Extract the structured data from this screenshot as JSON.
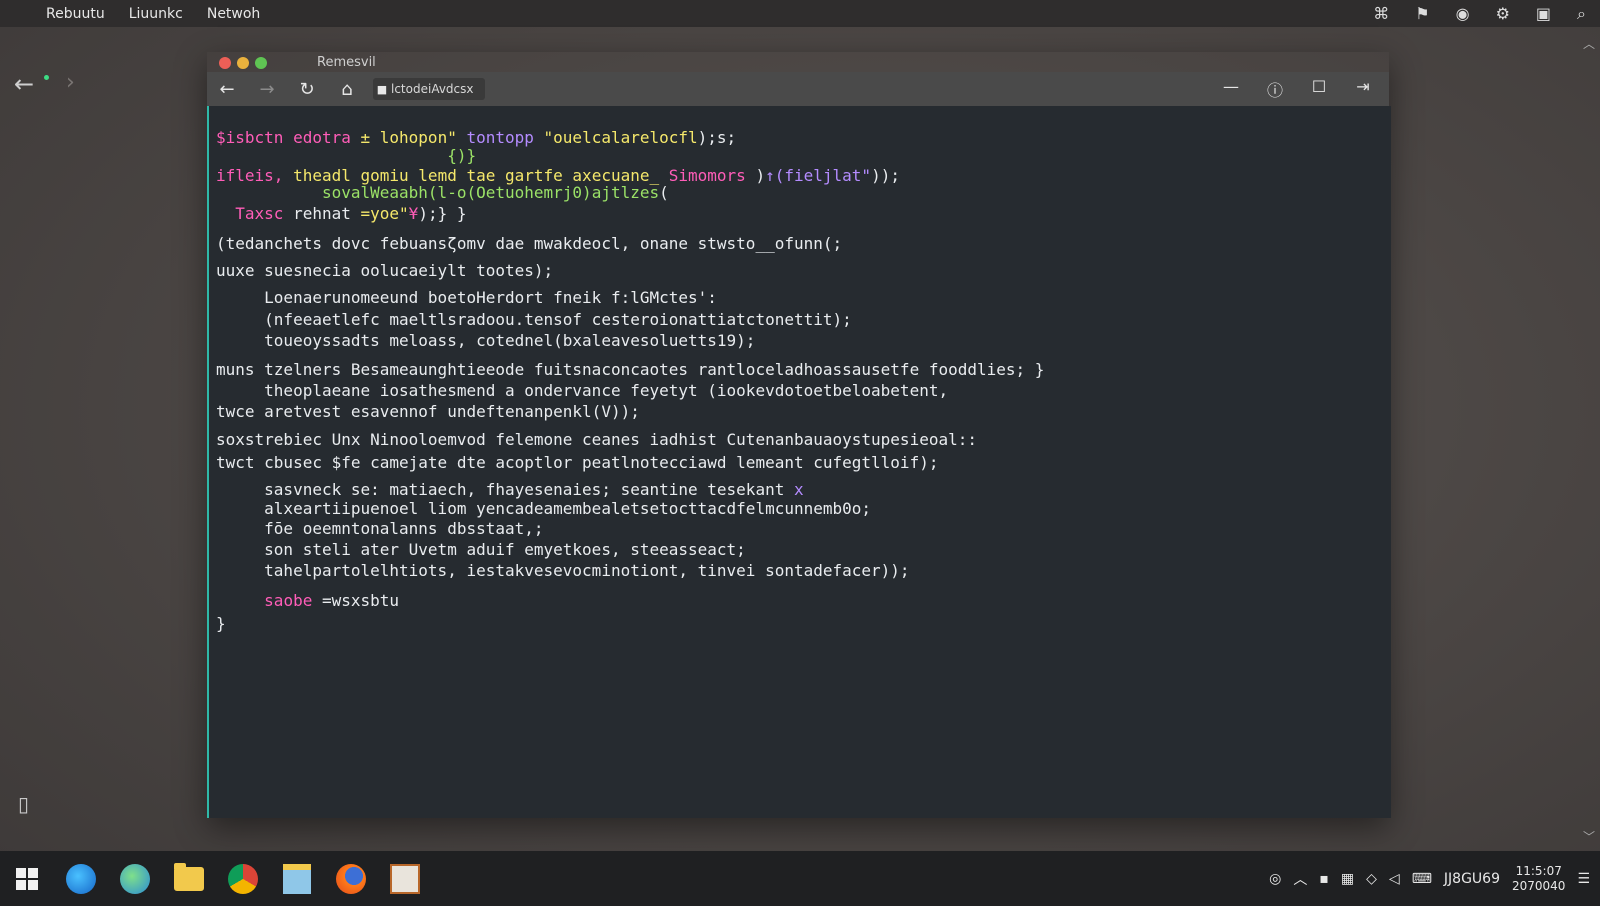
{
  "menubar": {
    "apple_icon": "apple-logo",
    "items": [
      "Rebuutu",
      "Liuunkc",
      "Netwoh"
    ],
    "right_icons": [
      "network-icon",
      "folder-flag-icon",
      "shield-icon",
      "settings-icon",
      "user-box-icon",
      "search-icon"
    ]
  },
  "window": {
    "title": "Remesvil",
    "address": "lctodeiAvdcsx",
    "toolbar_icons": [
      "back-icon",
      "forward-icon",
      "reload-icon",
      "home-icon",
      "lock-icon"
    ],
    "window_controls": [
      "minimize-icon",
      "info-icon",
      "maximize-icon",
      "forward-arrow-icon"
    ]
  },
  "code": {
    "lines": [
      {
        "segments": [
          {
            "t": "$isbctn edotra ",
            "c": "pink"
          },
          {
            "t": "± ",
            "c": "yellow"
          },
          {
            "t": "lohopon\" ",
            "c": "yellow"
          },
          {
            "t": "tontopp ",
            "c": "purple"
          },
          {
            "t": "\"ouelcalarelocfl",
            "c": "yellow"
          },
          {
            "t": ");s;",
            "c": "white"
          }
        ]
      },
      {
        "segments": [
          {
            "t": "                        {)}",
            "c": "green"
          }
        ]
      },
      {
        "segments": [
          {
            "t": "ifleis, ",
            "c": "pink"
          },
          {
            "t": "theadl ",
            "c": "yellow"
          },
          {
            "t": "gomiu lemd tae gartfe axecuane_ ",
            "c": "yellow"
          },
          {
            "t": "Simomors ",
            "c": "pink"
          },
          {
            "t": ")",
            "c": "white"
          },
          {
            "t": "↑(fieljlat\"",
            "c": "purple"
          },
          {
            "t": "));",
            "c": "white"
          }
        ]
      },
      {
        "segments": [
          {
            "t": "           sovalWeaabh(l-o(Oetuohemrj0)",
            "c": "green"
          },
          {
            "t": "ajtlzes",
            "c": "green"
          },
          {
            "t": "(",
            "c": "white"
          }
        ]
      },
      {
        "segments": [
          {
            "t": "  ",
            "c": "white"
          },
          {
            "t": "Taxsc ",
            "c": "pink"
          },
          {
            "t": "rehnat ",
            "c": "white"
          },
          {
            "t": "=yoe\"",
            "c": "yellow"
          },
          {
            "t": "¥",
            "c": "pink"
          },
          {
            "t": ");} }",
            "c": "white"
          }
        ]
      },
      {
        "segments": [
          {
            "t": "(tedanchets dovc febuansζomv dae mwakdeocl, onane stwsto__ofunn(;",
            "c": "white"
          }
        ]
      },
      {
        "segments": [
          {
            "t": "uuxe suesnecia oolucaeiylt tootes);",
            "c": "white"
          }
        ]
      },
      {
        "segments": [
          {
            "t": "     Loenaerunomeeund boetoHerdort fneik f:lGMctes':",
            "c": "white"
          }
        ]
      },
      {
        "segments": [
          {
            "t": "     (nfeeaetlefc maeltlsradoou.tensof cesteroionattiatctonettit);",
            "c": "white"
          }
        ]
      },
      {
        "segments": [
          {
            "t": "     toueoyssadts meloass, cotednel(bxaleavesoluetts19);",
            "c": "white"
          }
        ]
      },
      {
        "segments": [
          {
            "t": "muns tzelners Besameaunghtieeode fuitsnaconcaotes rantloceladhoassausetfe fooddlies; }",
            "c": "white"
          }
        ]
      },
      {
        "segments": [
          {
            "t": "     theoplaeane iosathesmend a ondervance feyetyt (iookevdotoetbeloabetent,",
            "c": "white"
          }
        ]
      },
      {
        "segments": [
          {
            "t": "twce aretvest esavennof undeftenanpenkl(V));",
            "c": "white"
          }
        ]
      },
      {
        "segments": [
          {
            "t": "soxstrebiec Unx Ninooloemvod felemone ceanes iadhist Cutenanbauaoystupesieoal::",
            "c": "white"
          }
        ]
      },
      {
        "segments": [
          {
            "t": "twct cbusec $fe camejate dte acoptlor peatlnotecciawd lemeant cufegtlloif);",
            "c": "white"
          }
        ]
      },
      {
        "segments": [
          {
            "t": "     sasvneck se: matiaech, fhayesenaies; seantine tesekant ",
            "c": "white"
          },
          {
            "t": "x",
            "c": "purple"
          }
        ]
      },
      {
        "segments": [
          {
            "t": "     alxeartiipuenoel liom yencadeamembealetsetocttacdfelmcunnemb0o;",
            "c": "white"
          }
        ]
      },
      {
        "segments": [
          {
            "t": "     fōe oeemntonalanns dbsstaat,;",
            "c": "white"
          }
        ]
      },
      {
        "segments": [
          {
            "t": "     son steli ater Uvetm aduif emyetkoes, steeasseact;",
            "c": "white"
          }
        ]
      },
      {
        "segments": [
          {
            "t": "     tahelpartolelhtiots, iestakvesevocminotiont, tinvei sontadefacer));",
            "c": "white"
          }
        ]
      },
      {
        "segments": [
          {
            "t": "     ",
            "c": "white"
          },
          {
            "t": "saobe ",
            "c": "pink"
          },
          {
            "t": "=wsxsbtu",
            "c": "white"
          }
        ]
      },
      {
        "segments": [
          {
            "t": "}",
            "c": "white"
          }
        ]
      }
    ]
  },
  "taskbar": {
    "apps": [
      "windows-start",
      "edge",
      "ie",
      "file-explorer",
      "chrome",
      "file-manager",
      "firefox",
      "app-window"
    ],
    "tray_text": "JJ8GU69",
    "clock_time": "11:5:07",
    "clock_date": "2070040"
  }
}
